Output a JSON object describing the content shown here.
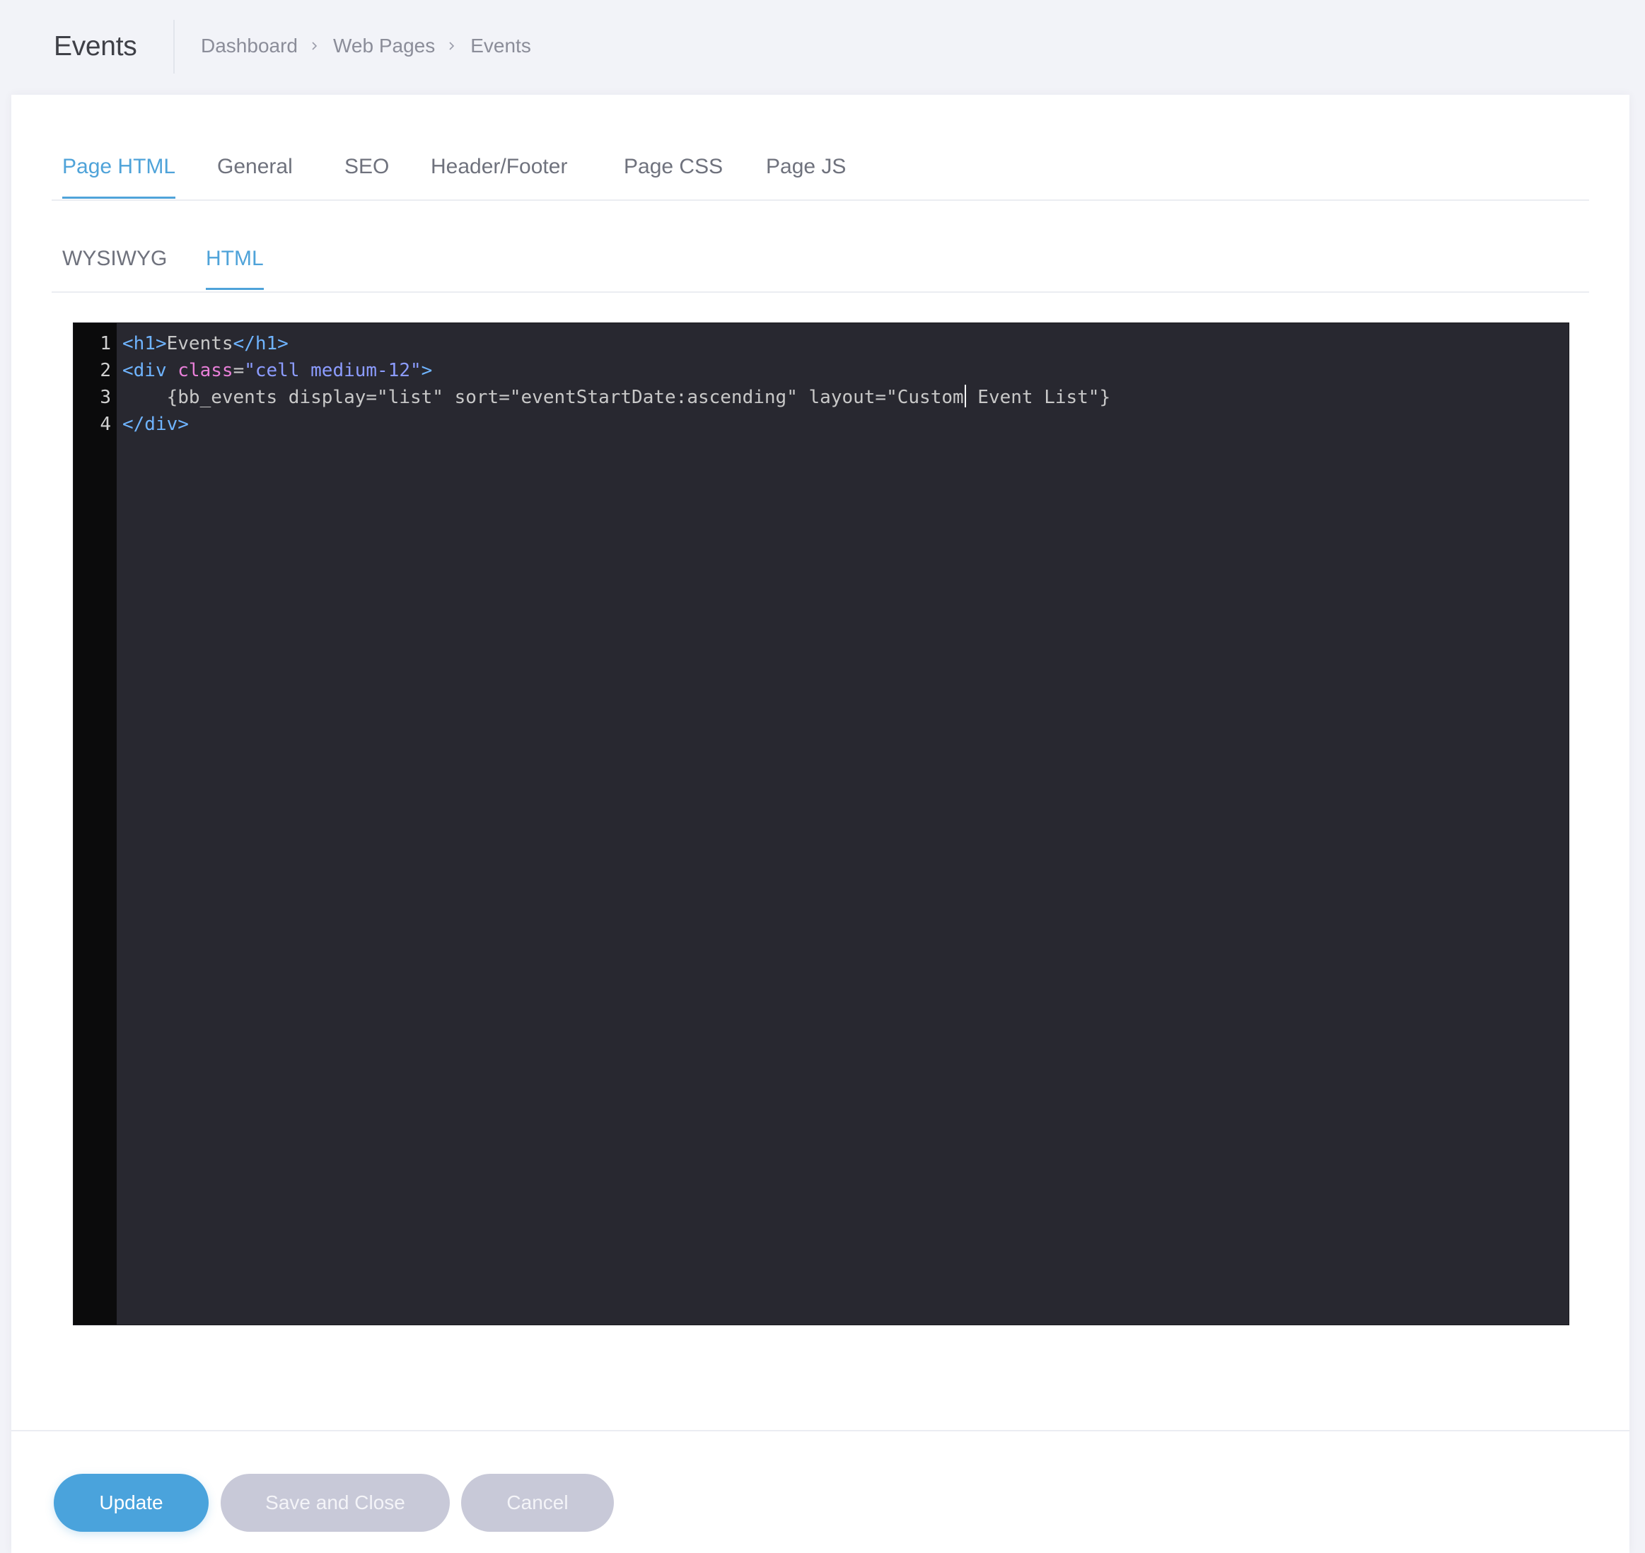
{
  "subheader": {
    "title": "Events",
    "breadcrumb": [
      "Dashboard",
      "Web Pages",
      "Events"
    ]
  },
  "tabs": {
    "primary": [
      "Page HTML",
      "General",
      "SEO",
      "Header/Footer",
      "Page CSS",
      "Page JS"
    ],
    "primary_active": "Page HTML",
    "secondary": [
      "WYSIWYG",
      "HTML"
    ],
    "secondary_active": "HTML"
  },
  "editor": {
    "line_numbers": [
      "1",
      "2",
      "3",
      "4"
    ],
    "lines": [
      [
        {
          "text": "<h1>",
          "kind": "tag"
        },
        {
          "text": "Events",
          "kind": "text"
        },
        {
          "text": "</h1>",
          "kind": "tag"
        }
      ],
      [
        {
          "text": "<div ",
          "kind": "tag"
        },
        {
          "text": "class",
          "kind": "attr"
        },
        {
          "text": "=",
          "kind": "text"
        },
        {
          "text": "\"cell medium-12\"",
          "kind": "string"
        },
        {
          "text": ">",
          "kind": "tag"
        }
      ],
      [
        {
          "text": "    {bb_events display=\"list\" sort=\"eventStartDate:ascending\" layout=\"Custom",
          "kind": "text"
        },
        {
          "text": "",
          "kind": "cursor"
        },
        {
          "text": " Event List\"}",
          "kind": "text"
        }
      ],
      [
        {
          "text": "</div>",
          "kind": "tag"
        }
      ]
    ],
    "colors": {
      "background": "#282830",
      "gutter": "#0b0b0c",
      "tag": "#6fb4ff",
      "attr": "#e87fd8",
      "string": "#8c9cff",
      "text": "#c8c8c8"
    }
  },
  "footer": {
    "update_label": "Update",
    "save_close_label": "Save and Close",
    "cancel_label": "Cancel"
  },
  "colors": {
    "accent": "#4fa3d9",
    "button_primary": "#4aa3dc",
    "button_secondary": "#c8c9d8",
    "page_background": "#f2f3f8"
  }
}
